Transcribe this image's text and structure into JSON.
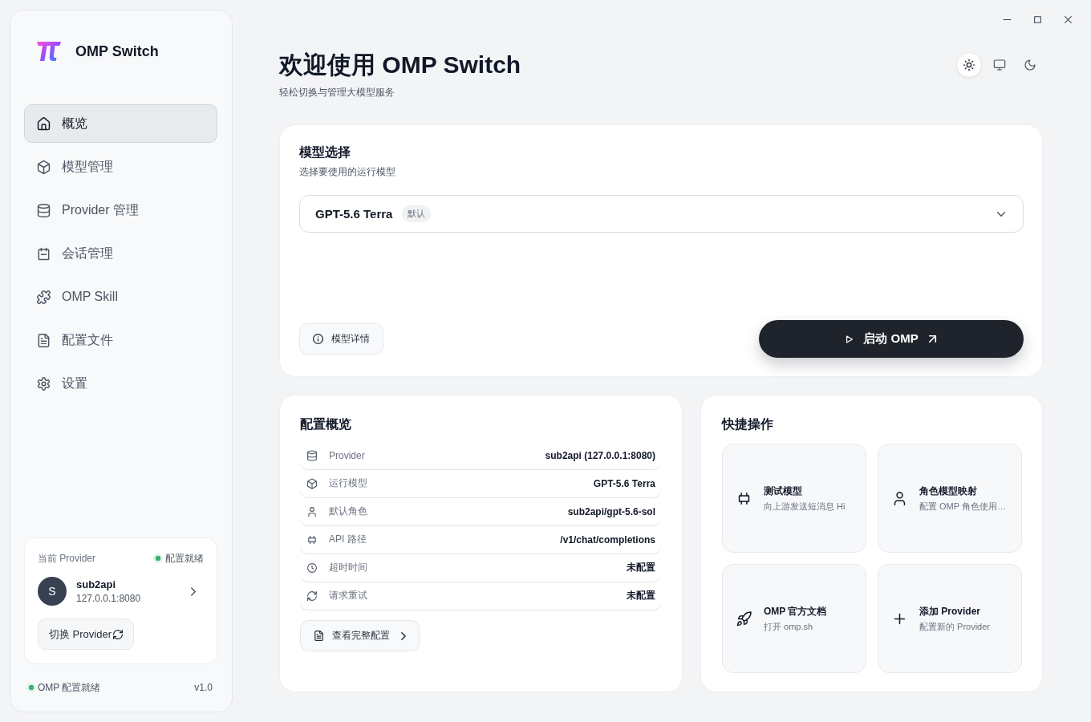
{
  "sidebar": {
    "app_name": "OMP Switch",
    "nav": [
      {
        "label": "概览",
        "selected": true
      },
      {
        "label": "模型管理",
        "selected": false
      },
      {
        "label": "Provider 管理",
        "selected": false
      },
      {
        "label": "会话管理",
        "selected": false
      },
      {
        "label": "OMP Skill",
        "selected": false
      },
      {
        "label": "配置文件",
        "selected": false
      },
      {
        "label": "设置",
        "selected": false
      }
    ],
    "current_provider": {
      "heading": "当前 Provider",
      "status": "配置就绪",
      "avatar": "S",
      "name": "sub2api",
      "address": "127.0.0.1:8080",
      "switch_button": "切换 Provider"
    },
    "footer": {
      "status": "OMP 配置就绪",
      "version": "v1.0"
    }
  },
  "header": {
    "title": "欢迎使用 OMP Switch",
    "subtitle": "轻松切换与管理大模型服务",
    "theme_options": [
      {
        "kind": "light",
        "selected": true
      },
      {
        "kind": "system",
        "selected": false
      },
      {
        "kind": "dark",
        "selected": false
      }
    ]
  },
  "model_card": {
    "title": "模型选择",
    "subtitle": "选择要使用的运行模型",
    "selected_model": "GPT-5.6 Terra",
    "badge": "默认",
    "details_button": "模型详情",
    "launch_button": "启动 OMP"
  },
  "config_card": {
    "title": "配置概览",
    "rows": [
      {
        "label": "Provider",
        "value": "sub2api (127.0.0.1:8080)"
      },
      {
        "label": "运行模型",
        "value": "GPT-5.6 Terra"
      },
      {
        "label": "默认角色",
        "value": "sub2api/gpt-5.6-sol"
      },
      {
        "label": "API 路径",
        "value": "/v1/chat/completions"
      },
      {
        "label": "超时时间",
        "value": "未配置"
      },
      {
        "label": "请求重试",
        "value": "未配置"
      }
    ],
    "view_button": "查看完整配置"
  },
  "quick_actions": {
    "title": "快捷操作",
    "items": [
      {
        "title": "测试模型",
        "description": "向上游发送短消息 Hi"
      },
      {
        "title": "角色模型映射",
        "description": "配置 OMP 角色使用…"
      },
      {
        "title": "OMP 官方文档",
        "description": "打开 omp.sh"
      },
      {
        "title": "添加 Provider",
        "description": "配置新的 Provider"
      }
    ]
  }
}
